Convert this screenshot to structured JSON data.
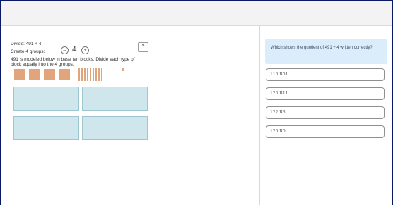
{
  "problem": {
    "title": "Divide: 491 ÷ 4",
    "groups_label": "Create 4 groups:",
    "minus": "–",
    "group_count": "4",
    "plus": "+",
    "help": "?",
    "instruction_line1": "491 is modeled below in base ten blocks. Divide each type of",
    "instruction_line2": "block equally into the 4 groups.",
    "blocks": {
      "hundreds": 4,
      "tens": 9,
      "ones": 1
    },
    "group_zones": 4
  },
  "question": {
    "text": "Which shows the quotient of 491 ÷ 4 written correctly?",
    "options": [
      "110 R51",
      "120 R11",
      "122 R3",
      "125 R0"
    ]
  },
  "colors": {
    "block": "#e0a57a",
    "zone": "#cfe7ec",
    "question_bg": "#dbecfb"
  }
}
